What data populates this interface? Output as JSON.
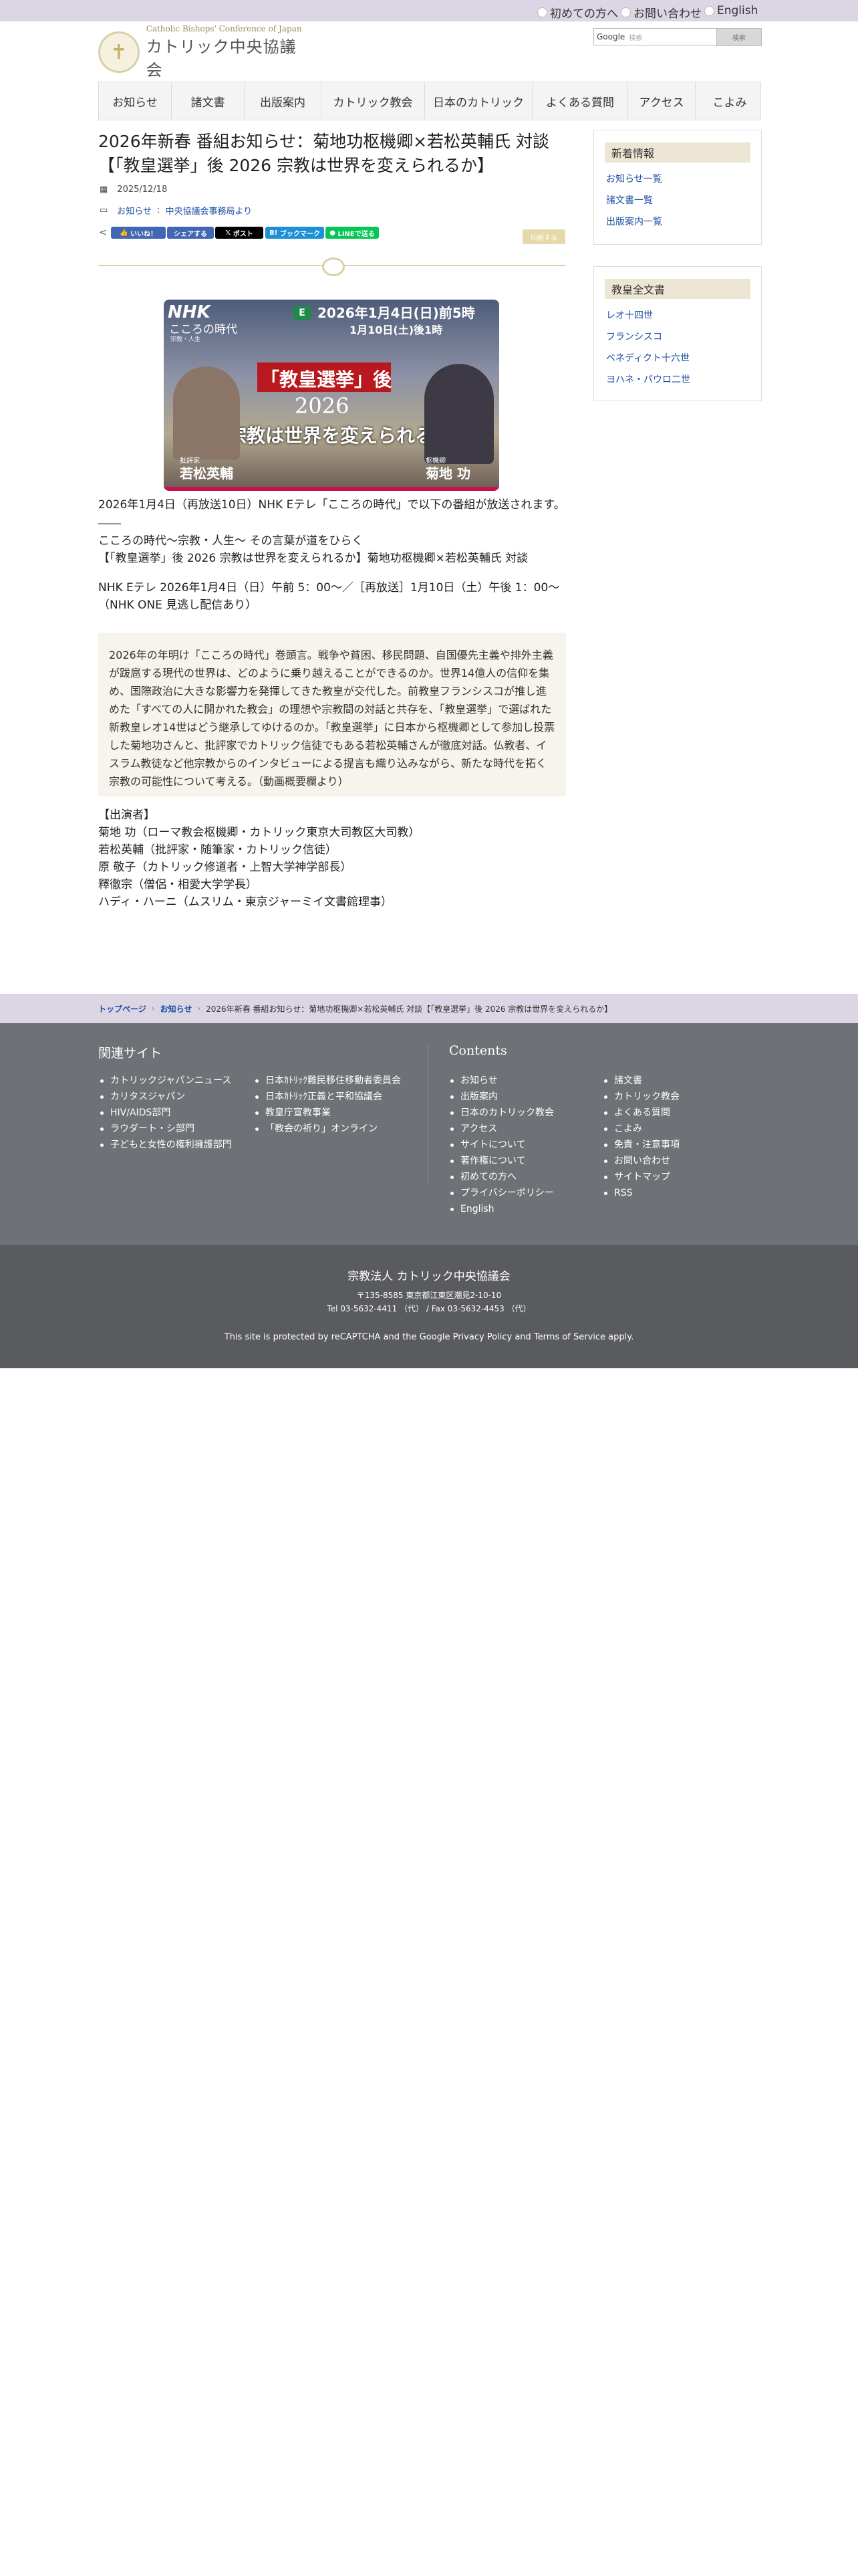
{
  "topbar": {
    "links": [
      "初めての方へ",
      "お問い合わせ",
      "English"
    ]
  },
  "header": {
    "logo_small": "Catholic Bishops' Conference of Japan",
    "logo_big": "カトリック中央協議会",
    "search_label": "Google",
    "search_placeholder": "検索",
    "search_button": "検索"
  },
  "nav": {
    "items": [
      "お知らせ",
      "諸文書",
      "出版案内",
      "カトリック教会",
      "日本のカトリック",
      "よくある質問",
      "アクセス",
      "こよみ"
    ]
  },
  "article": {
    "title": "2026年新春 番組お知らせ：菊地功枢機卿×若松英輔氏 対談【「教皇選挙」後 2026 宗教は世界を変えられるか】",
    "date": "2025/12/18",
    "categories": [
      "お知らせ",
      "中央協議会事務局より"
    ],
    "share": {
      "like": "いいね！",
      "share": "シェアする",
      "post": "ポスト",
      "bookmark": "ブックマーク",
      "line": "LINEで送る",
      "print": "印刷する"
    },
    "hero": {
      "program": "こころの時代",
      "program_sub": "宗教・人生",
      "channel": "E",
      "airtime": "2026年1月4日(日)前5時",
      "rerun": "1月10日(土)後1時",
      "headline_1": "「教皇選挙」後",
      "headline_2": "2026",
      "headline_3": "宗教は世界を変えられるか",
      "guest_left": "若松英輔",
      "guest_left_role": "批評家",
      "guest_right": "菊地 功",
      "guest_right_role": "枢機卿"
    },
    "para1": "2026年1月4日（再放送10日）NHK Eテレ「こころの時代」で以下の番組が放送されます。",
    "dash": "――",
    "para2a": "こころの時代〜宗教・人生〜 その言葉が道をひらく",
    "para2b": "【「教皇選挙」後 2026 宗教は世界を変えられるか】菊地功枢機卿×若松英輔氏 対談",
    "para3": "NHK Eテレ 2026年1月4日（日）午前 5：00〜／［再放送］1月10日（土）午後 1：00〜（NHK ONE 見逃し配信あり）",
    "quote": "2026年の年明け「こころの時代」巻頭言。戦争や貧困、移民問題、自国優先主義や排外主義が跋扈する現代の世界は、どのように乗り越えることができるのか。世界14億人の信仰を集め、国際政治に大きな影響力を発揮してきた教皇が交代した。前教皇フランシスコが推し進めた「すべての人に開かれた教会」の理想や宗教間の対話と共存を、「教皇選挙」で選ばれた新教皇レオ14世はどう継承してゆけるのか。「教皇選挙」に日本から枢機卿として参加し投票した菊地功さんと、批評家でカトリック信徒でもある若松英輔さんが徹底対話。仏教者、イスラム教徒など他宗教からのインタビューによる提言も織り込みながら、新たな時代を拓く宗教の可能性について考える。（動画概要欄より）",
    "cast_heading": "【出演者】",
    "cast": [
      "菊地 功（ローマ教会枢機卿・カトリック東京大司教区大司教）",
      "若松英輔（批評家・随筆家・カトリック信徒）",
      "原 敬子（カトリック修道者・上智大学神学部長）",
      "釋徹宗（僧侶・相愛大学学長）",
      "ハディ・ハーニ（ムスリム・東京ジャーミイ文書館理事）"
    ]
  },
  "sidebar": {
    "news_title": "新着情報",
    "news_links": [
      "お知らせ一覧",
      "諸文書一覧",
      "出版案内一覧"
    ],
    "docs_title": "教皇全文書",
    "docs_links": [
      "レオ十四世",
      "フランシスコ",
      "ベネディクト十六世",
      "ヨハネ・パウロ二世"
    ]
  },
  "breadcrumb": {
    "home": "トップページ",
    "section": "お知らせ",
    "current": "2026年新春 番組お知らせ：菊地功枢機卿×若松英輔氏 対談【「教皇選挙」後 2026 宗教は世界を変えられるか】"
  },
  "footer": {
    "related_title": "関連サイト",
    "related_col1": [
      "カトリックジャパンニュース",
      "カリタスジャパン",
      "HIV/AIDS部門",
      "ラウダート・シ部門",
      "子どもと女性の権利擁護部門"
    ],
    "related_col2": [
      "日本ｶﾄﾘｯｸ難民移住移動者委員会",
      "日本ｶﾄﾘｯｸ正義と平和協議会",
      "教皇庁宣教事業",
      "「教会の祈り」オンライン"
    ],
    "contents_title": "Contents",
    "contents_col1": [
      "お知らせ",
      "出版案内",
      "日本のカトリック教会",
      "アクセス",
      "サイトについて",
      "著作権について",
      "初めての方へ",
      "プライバシーポリシー",
      "English"
    ],
    "contents_col2": [
      "諸文書",
      "カトリック教会",
      "よくある質問",
      "こよみ",
      "免責・注意事項",
      "お問い合わせ",
      "サイトマップ",
      "RSS"
    ],
    "org_name": "宗教法人 カトリック中央協議会",
    "address": "〒135-8585 東京都江東区潮見2-10-10",
    "phone": "Tel 03-5632-4411 （代）  / Fax 03-5632-4453 （代）",
    "recaptcha": "This site is protected by reCAPTCHA and the Google Privacy Policy and Terms of Service apply."
  }
}
